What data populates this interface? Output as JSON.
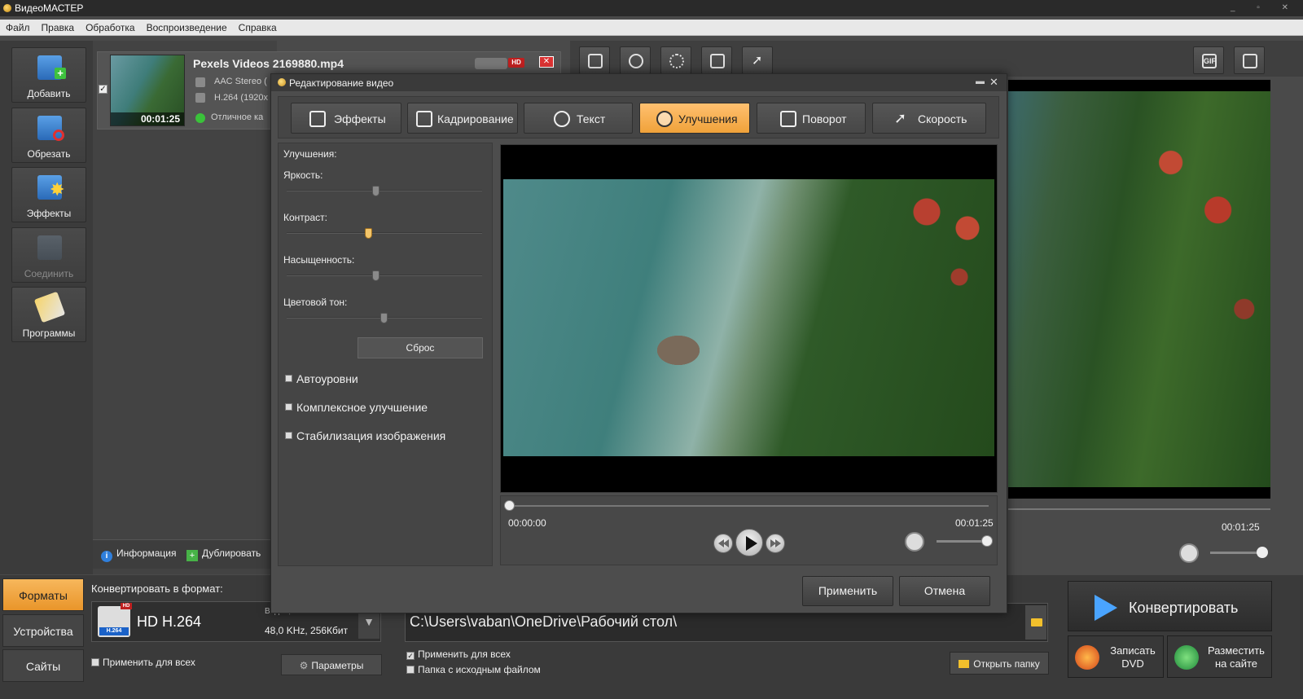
{
  "window": {
    "title": "ВидеоМАСТЕР",
    "controls": "_ ▫ ✕"
  },
  "menu": [
    "Файл",
    "Правка",
    "Обработка",
    "Воспроизведение",
    "Справка"
  ],
  "sidebar": {
    "items": [
      {
        "label": "Добавить",
        "icon": "add-video-icon"
      },
      {
        "label": "Обрезать",
        "icon": "scissors-icon"
      },
      {
        "label": "Эффекты",
        "icon": "effects-star-icon"
      },
      {
        "label": "Соединить",
        "icon": "join-icon",
        "disabled": true
      },
      {
        "label": "Программы",
        "icon": "programs-icon"
      }
    ]
  },
  "file": {
    "name": "Pexels Videos 2169880.mp4",
    "duration": "00:01:25",
    "audio": "AAC Stereo (",
    "video": "H.264 (1920x",
    "quality": "Отличное ка",
    "badge": "HD",
    "remove": "✕",
    "checked": "✓"
  },
  "file_actions": {
    "info": "Информация",
    "duplicate": "Дублировать"
  },
  "dialog": {
    "title": "Редактирование видео",
    "minimize": "▬",
    "close": "✕",
    "tabs": [
      {
        "label": "Эффекты",
        "icon": "effects-tab-icon"
      },
      {
        "label": "Кадрирование",
        "icon": "crop-tab-icon"
      },
      {
        "label": "Текст",
        "icon": "text-tab-icon"
      },
      {
        "label": "Улучшения",
        "icon": "enhance-tab-icon",
        "active": true
      },
      {
        "label": "Поворот",
        "icon": "rotate-tab-icon"
      },
      {
        "label": "Скорость",
        "icon": "speed-tab-icon"
      }
    ],
    "enhancements": {
      "heading": "Улучшения:",
      "brightness": {
        "label": "Яркость:",
        "value": 0.46
      },
      "contrast": {
        "label": "Контраст:",
        "value": 0.42
      },
      "saturation": {
        "label": "Насыщенность:",
        "value": 0.46
      },
      "hue": {
        "label": "Цветовой тон:",
        "value": 0.5
      },
      "reset": "Сброс",
      "options": [
        "Автоуровни",
        "Комплексное улучшение",
        "Стабилизация изображения"
      ]
    },
    "player": {
      "time_start": "00:00:00",
      "time_end": "00:01:25",
      "progress": 0.0,
      "volume": 1.0
    },
    "apply": "Применить",
    "cancel": "Отмена"
  },
  "background_preview": {
    "time_end": "00:01:25"
  },
  "bottom": {
    "nav": [
      "Форматы",
      "Устройства",
      "Сайты"
    ],
    "convert_label": "Конвертировать в формат:",
    "format": {
      "name": "HD H.264",
      "spec_top": "Видео, ...",
      "spec": "48,0 KHz, 256Кбит",
      "icon_tag": "H.264",
      "badge": "HD",
      "dropdown": "▼"
    },
    "apply_all_format": "Применить для всех",
    "params": "Параметры",
    "output_path": "C:\\Users\\vaban\\OneDrive\\Рабочий стол\\",
    "apply_all_output": "Применить для всех",
    "source_folder": "Папка с исходным файлом",
    "open_folder": "Открыть папку",
    "convert": "Конвертировать",
    "dvd": "Записать\nDVD",
    "dvd_line1": "Записать",
    "dvd_line2": "DVD",
    "web_line1": "Разместить",
    "web_line2": "на сайте"
  },
  "toolbar_icons": [
    "crop-icon",
    "camera-icon",
    "brightness-icon",
    "rotate-icon",
    "speed-runner-icon",
    "gif-icon",
    "fullscreen-icon"
  ],
  "gif_label": "GIF"
}
